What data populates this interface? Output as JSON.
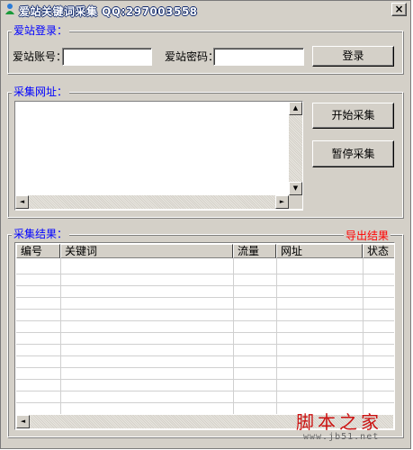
{
  "window": {
    "title": "爱站关键词采集  QQ:297003558",
    "close_glyph": "×"
  },
  "login": {
    "legend": "爱站登录：",
    "account_label": "爱站账号：",
    "account_value": "",
    "password_label": "爱站密码：",
    "password_value": "",
    "login_button": "登录"
  },
  "collect_url": {
    "legend": "采集网址：",
    "textarea_value": "",
    "start_button": "开始采集",
    "pause_button": "暂停采集"
  },
  "results": {
    "legend": "采集结果：",
    "export_link": "导出结果",
    "columns": [
      "编号",
      "关键词",
      "流量",
      "网址",
      "状态"
    ],
    "rows": []
  },
  "scroll_glyphs": {
    "up": "▲",
    "down": "▼",
    "left": "◄",
    "right": "►"
  },
  "watermark": {
    "main": "脚本之家",
    "sub": "www.jb51.net"
  },
  "colors": {
    "legend": "#0000ff",
    "export": "#ff0000",
    "face": "#d4d0c8"
  }
}
